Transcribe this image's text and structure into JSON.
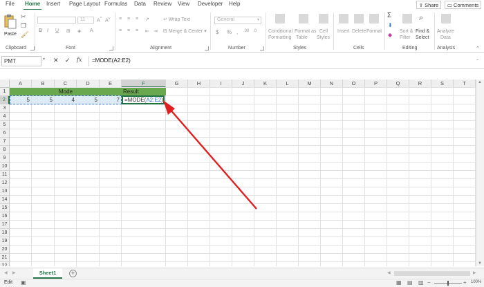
{
  "menu": {
    "tabs": [
      "File",
      "Home",
      "Insert",
      "Page Layout",
      "Formulas",
      "Data",
      "Review",
      "View",
      "Developer",
      "Help"
    ],
    "share_label": "Share",
    "comments_label": "Comments"
  },
  "ribbon": {
    "clipboard": {
      "paste_label": "Paste",
      "group_label": "Clipboard"
    },
    "font": {
      "size": "11",
      "group_label": "Font"
    },
    "alignment": {
      "wrap_text": "Wrap Text",
      "merge_center": "Merge & Center",
      "group_label": "Alignment"
    },
    "number": {
      "format": "General",
      "group_label": "Number"
    },
    "styles": {
      "conditional_line1": "Conditional",
      "conditional_line2": "Formatting",
      "format_table_line1": "Format as",
      "format_table_line2": "Table",
      "cell_styles_line1": "Cell",
      "cell_styles_line2": "Styles",
      "group_label": "Styles"
    },
    "cells": {
      "insert": "Insert",
      "delete": "Delete",
      "format": "Format",
      "group_label": "Cells"
    },
    "editing": {
      "sort_line1": "Sort &",
      "sort_line2": "Filter",
      "find_line1": "Find &",
      "find_line2": "Select",
      "group_label": "Editing"
    },
    "analysis": {
      "analyze_line1": "Analyze",
      "analyze_line2": "Data",
      "group_label": "Analysis"
    }
  },
  "formula_bar": {
    "name_box": "PMT",
    "formula": "=MODE(A2:E2)"
  },
  "grid": {
    "columns": [
      "A",
      "B",
      "C",
      "D",
      "E",
      "F",
      "G",
      "H",
      "I",
      "J",
      "K",
      "L",
      "M",
      "N",
      "O",
      "P",
      "Q",
      "R",
      "S",
      "T"
    ],
    "rows": [
      "1",
      "2",
      "3",
      "4",
      "5",
      "6",
      "7",
      "8",
      "9",
      "10",
      "11",
      "12",
      "13",
      "14",
      "15",
      "16",
      "17",
      "18",
      "19",
      "20",
      "21",
      "22"
    ],
    "header_mode": "Mode",
    "header_result": "Result",
    "values": [
      "5",
      "5",
      "4",
      "5",
      "7"
    ],
    "edit_prefix": "=MODE(",
    "edit_ref": "A2:E2",
    "edit_suffix": ")"
  },
  "sheets": {
    "active": "Sheet1",
    "add_label": "+"
  },
  "status": {
    "mode": "Edit",
    "zoom": "100%"
  },
  "colors": {
    "accent": "#217346",
    "header_fill": "#6aa84f",
    "arrow": "#e02020",
    "selection": "#ddebf7"
  }
}
